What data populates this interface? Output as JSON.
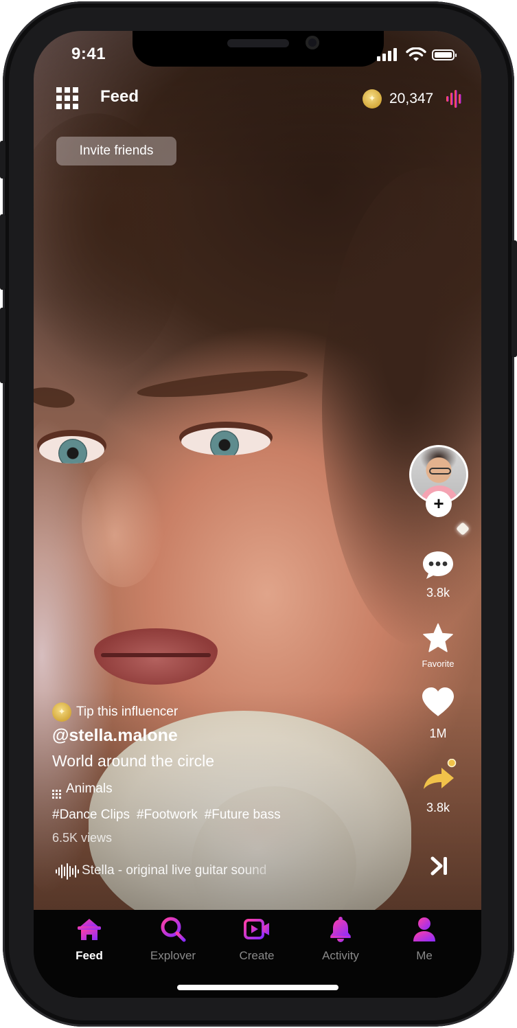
{
  "status_bar": {
    "time": "9:41"
  },
  "header": {
    "title": "Feed",
    "coin_balance": "20,347",
    "invite_button": "Invite friends"
  },
  "rail": {
    "comments_count": "3.8k",
    "favorite_label": "Favorite",
    "likes_count": "1M",
    "shares_count": "3.8k"
  },
  "post": {
    "tip_label": "Tip this influencer",
    "username": "@stella.malone",
    "caption": "World around the circle",
    "category": "Animals",
    "hashtags": [
      "#Dance Clips",
      "#Footwork",
      "#Future bass"
    ],
    "views": "6.5K views",
    "sound": "Stella - original live guitar sound"
  },
  "nav": {
    "items": [
      {
        "label": "Feed",
        "icon": "home-icon",
        "active": true
      },
      {
        "label": "Explover",
        "icon": "search-icon",
        "active": false
      },
      {
        "label": "Create",
        "icon": "video-camera-icon",
        "active": false
      },
      {
        "label": "Activity",
        "icon": "bell-icon",
        "active": false
      },
      {
        "label": "Me",
        "icon": "user-icon",
        "active": false
      }
    ]
  },
  "colors": {
    "accent_pink": "#ff3fa4",
    "accent_purple": "#8a2cff",
    "coin_gold": "#e3bb4f",
    "share_yellow": "#f1c24a",
    "nav_background": "#050505"
  }
}
